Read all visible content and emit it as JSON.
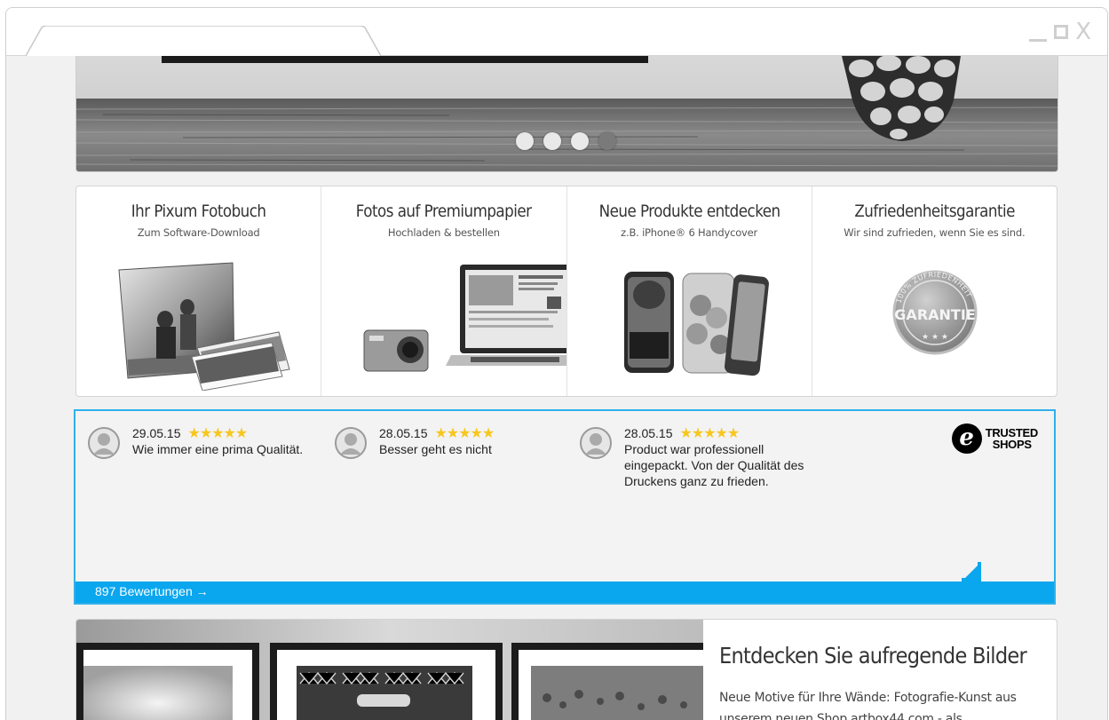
{
  "window": {
    "controls": {
      "minimize": "minimize-icon",
      "maximize": "maximize-icon",
      "close_label": "X"
    }
  },
  "hero": {
    "slide_count": 4,
    "active_slide": 4
  },
  "promo_cards": [
    {
      "title": "Ihr Pixum Fotobuch",
      "subtitle": "Zum Software-Download"
    },
    {
      "title": "Fotos auf Premiumpapier",
      "subtitle": "Hochladen & bestellen"
    },
    {
      "title": "Neue Produkte entdecken",
      "subtitle": "z.B. iPhone® 6 Handycover"
    },
    {
      "title": "Zufriedenheitsgarantie",
      "subtitle": "Wir sind zufrieden, wenn Sie es sind.",
      "badge_text": "GARANTIE",
      "badge_ring_text": "100% ZUFRIEDENHEIT"
    }
  ],
  "reviews": {
    "items": [
      {
        "date": "29.05.15",
        "stars": "★★★★★",
        "rating": 5,
        "text": "Wie immer eine prima Qualität."
      },
      {
        "date": "28.05.15",
        "stars": "★★★★★",
        "rating": 5,
        "text": "Besser geht es nicht"
      },
      {
        "date": "28.05.15",
        "stars": "★★★★★",
        "rating": 5,
        "text": "Product war professionell eingepackt. Von der Qualität des Druckens ganz zu frieden."
      }
    ],
    "logo": {
      "mark": "e",
      "line1": "TRUSTED",
      "line2": "SHOPS"
    },
    "count_link": "897 Bewertungen →"
  },
  "art": {
    "title": "Entdecken Sie aufregende Bilder",
    "text": "Neue Motive für Ihre Wände: Fotografie-Kunst aus unserem neuen Shop artbox44.com - als"
  },
  "colors": {
    "accent_blue": "#0aa6ee",
    "border_blue": "#2fb1ea",
    "star_yellow": "#f7c71f",
    "page_bg": "#f1f1f1"
  }
}
